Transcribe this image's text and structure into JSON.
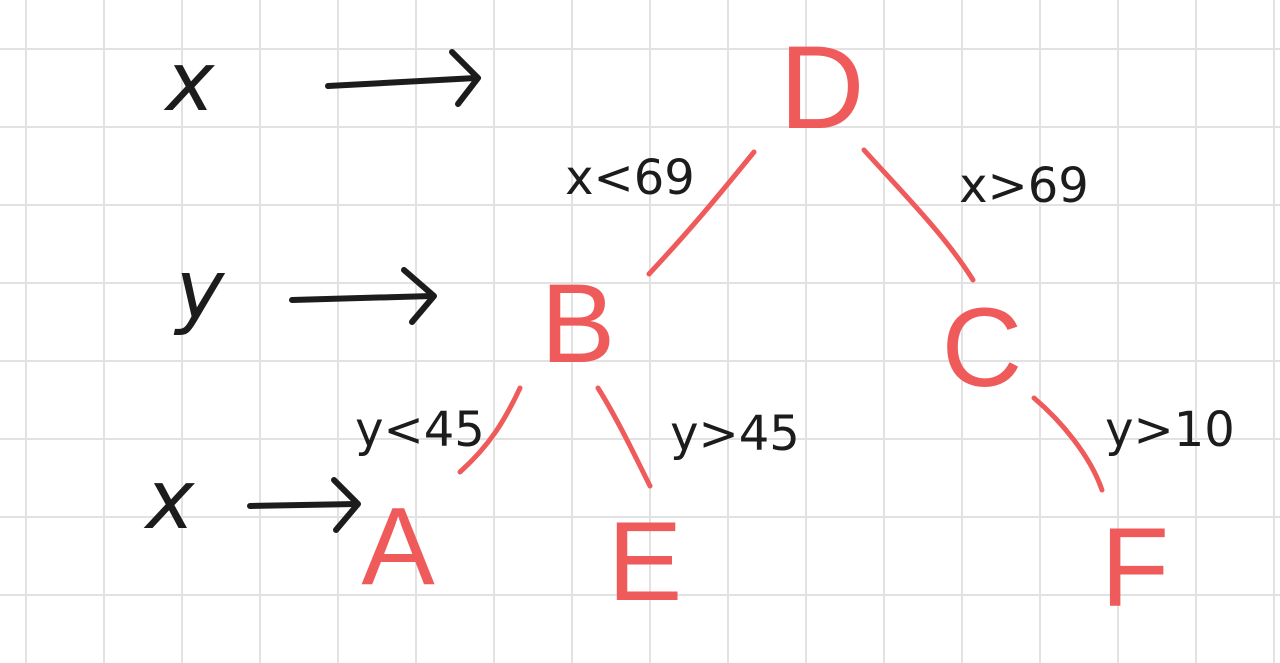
{
  "tree": {
    "nodes": {
      "root": "D",
      "left": "B",
      "right": "C",
      "left_left": "A",
      "left_right": "E",
      "right_right": "F"
    },
    "edges": {
      "d_to_b": "x<69",
      "d_to_c": "x>69",
      "b_to_a": "y<45",
      "b_to_e": "y>45",
      "c_to_f": "y>10"
    }
  },
  "levels": {
    "level0_axis": "x",
    "level1_axis": "y",
    "level2_axis": "x"
  },
  "colors": {
    "node_ink": "#ef5b5b",
    "edge_ink": "#ef5b5b",
    "label_ink": "#1c1c1c",
    "grid": "#e2e2e2",
    "background": "#ffffff"
  }
}
